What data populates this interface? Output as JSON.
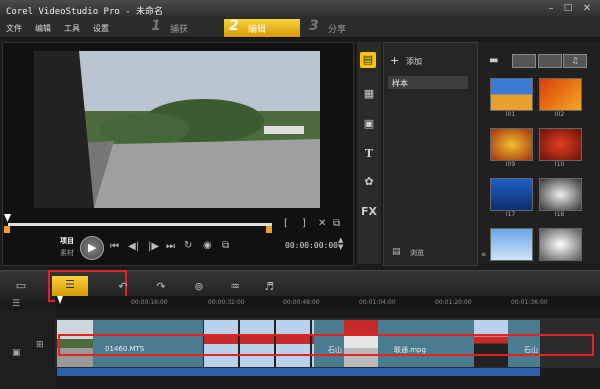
{
  "app": {
    "title": "Corel VideoStudio Pro - 未命名"
  },
  "menu": [
    "文件",
    "编辑",
    "工具",
    "设置"
  ],
  "steps": [
    {
      "num": "1",
      "label": "捕获",
      "active": false
    },
    {
      "num": "2",
      "label": "编辑",
      "active": true
    },
    {
      "num": "3",
      "label": "分享",
      "active": false
    }
  ],
  "player": {
    "mode_project": "项目",
    "mode_clip": "素材",
    "timecode": "00:00:00:00"
  },
  "library": {
    "add_label": "添加",
    "sample_label": "样本",
    "browse_label": "浏览",
    "fx_label": "FX",
    "thumbs": [
      "I01",
      "I02",
      "I09",
      "I10",
      "I17",
      "I18",
      "",
      ""
    ]
  },
  "timeline": {
    "ruler": [
      "00:00:16:00",
      "00:00:32:00",
      "00:00:48:00",
      "00:01:04:00",
      "00:01:20:00",
      "00:01:36:00"
    ],
    "clips": [
      {
        "label": "01460.MTS"
      },
      {
        "label": "石山"
      },
      {
        "label": "联通.mpg"
      },
      {
        "label": "石山"
      }
    ]
  },
  "colors": {
    "accent": "#f5c60e",
    "highlight": "#e32222"
  }
}
